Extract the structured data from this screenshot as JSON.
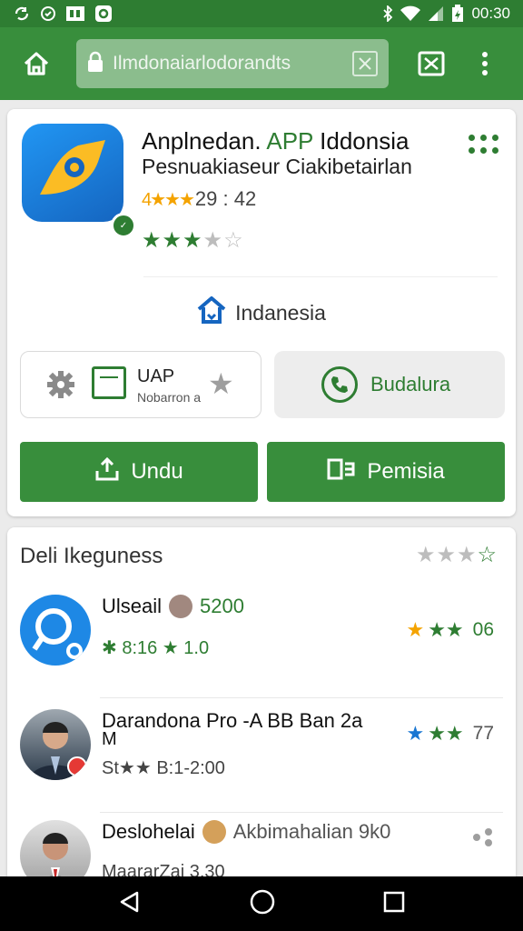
{
  "status_bar": {
    "time": "00:30",
    "icons": [
      "sync-icon",
      "shield-icon",
      "image-icon",
      "bluetooth-icon",
      "wifi-icon",
      "signal-icon",
      "battery-icon"
    ]
  },
  "browser": {
    "url": "Ilmdonaiarlodorandts",
    "home_icon": "home-icon",
    "lock_icon": "lock-icon",
    "clear_icon": "close-box-icon",
    "tabs_icon": "tabs-icon",
    "menu_icon": "more-vert-icon"
  },
  "app": {
    "title_part1": "Anplnedan.",
    "title_part2": "APP",
    "title_part3": "Iddonsia",
    "subtitle": "Pesnuakiaseur Ciakibetairlan",
    "rating_text": "29 : 42",
    "rating_stars": 3.5,
    "country_label": "Indanesia"
  },
  "options": {
    "opt1_title": "UAP",
    "opt1_sub": "Nobarron a",
    "opt2_label": "Budalura"
  },
  "buttons": {
    "download": "Undu",
    "share": "Pemisia"
  },
  "reviews_section": {
    "title": "Deli Ikeguness",
    "rating_stars": 3.5,
    "items": [
      {
        "name": "Ulseail",
        "count": "5200",
        "meta": "✱ 8:16 ★ 1.0",
        "score": "06",
        "star_color": "#2e7d32"
      },
      {
        "name": "Darandona Pro -A BB Ban 2a",
        "name_line2": "M",
        "meta": "St★★ B:1-2:00",
        "score": "77",
        "star_color": "#1976d2"
      },
      {
        "name": "Deslohelai",
        "extra": "Akbimahalian 9k0",
        "meta": "MaararZai 3.30",
        "score": ""
      }
    ]
  },
  "nav": {
    "back": "back-icon",
    "home": "home-circle-icon",
    "recents": "recents-icon"
  },
  "colors": {
    "primary": "#388e3c",
    "primary_dark": "#2e7d32",
    "accent_blue": "#1e88e5"
  }
}
